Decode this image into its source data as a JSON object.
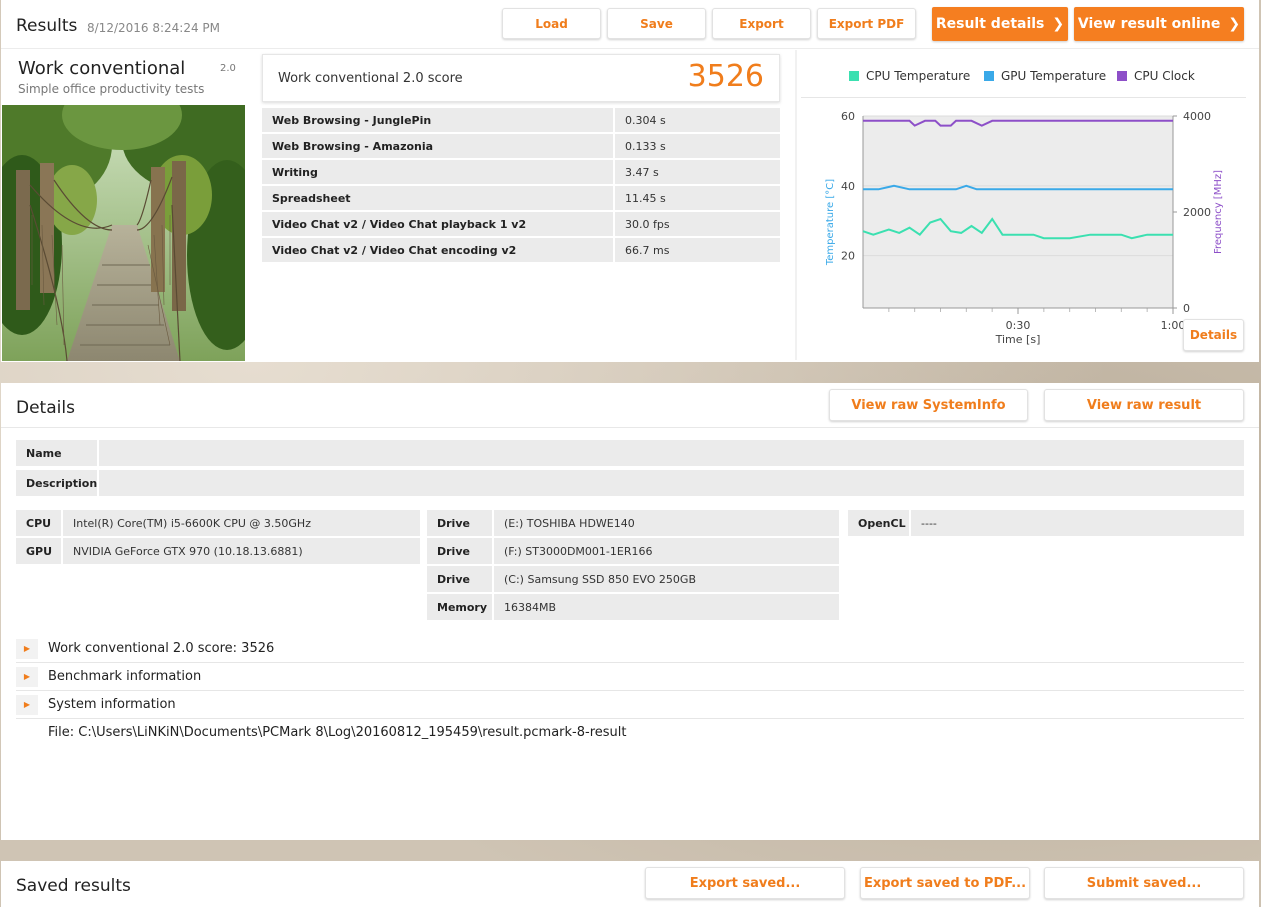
{
  "results": {
    "title": "Results",
    "timestamp": "8/12/2016 8:24:24 PM",
    "buttons": {
      "load": "Load",
      "save": "Save",
      "export": "Export",
      "export_pdf": "Export PDF"
    },
    "result_details": "Result details",
    "view_online": "View result online",
    "benchmark": {
      "name": "Work conventional",
      "version": "2.0",
      "subtitle": "Simple office productivity tests"
    },
    "score": {
      "label": "Work conventional 2.0 score",
      "value": "3526"
    },
    "subscores": [
      {
        "name": "Web Browsing - JunglePin",
        "value": "0.304 s"
      },
      {
        "name": "Web Browsing - Amazonia",
        "value": "0.133 s"
      },
      {
        "name": "Writing",
        "value": "3.47 s"
      },
      {
        "name": "Spreadsheet",
        "value": "11.45 s"
      },
      {
        "name": "Video Chat v2 / Video Chat playback 1 v2",
        "value": "30.0 fps"
      },
      {
        "name": "Video Chat v2 / Video Chat encoding v2",
        "value": "66.7 ms"
      }
    ],
    "details_button": "Details"
  },
  "chart_data": {
    "type": "line",
    "xlabel": "Time [s]",
    "ylabel_left": "Temperature [°C]",
    "ylabel_right": "Frequency [MHz]",
    "x_ticks": [
      "0:30",
      "1:00"
    ],
    "x_tick_values": [
      30,
      60
    ],
    "xlim": [
      0,
      60
    ],
    "y_left_ticks": [
      "20",
      "40",
      "60"
    ],
    "y_left_tick_values": [
      20,
      40,
      60
    ],
    "ylim_left": [
      5,
      60
    ],
    "y_right_ticks": [
      "0",
      "2000",
      "4000"
    ],
    "y_right_tick_values": [
      0,
      2000,
      4000
    ],
    "ylim_right": [
      0,
      4000
    ],
    "grid": true,
    "legend_position": "top",
    "series": [
      {
        "name": "CPU Temperature",
        "color": "#3be0b0",
        "axis": "left",
        "x": [
          0,
          2,
          5,
          7,
          9,
          11,
          13,
          15,
          17,
          19,
          21,
          23,
          25,
          27,
          29,
          31,
          33,
          35,
          40,
          44,
          47,
          50,
          52,
          55,
          60
        ],
        "values": [
          27,
          26,
          27.5,
          26.5,
          28,
          26,
          29.5,
          30.5,
          27,
          26.5,
          28.5,
          26.5,
          30.5,
          26,
          26,
          26,
          26,
          25,
          25,
          26,
          26,
          26,
          25,
          26,
          26
        ]
      },
      {
        "name": "GPU Temperature",
        "color": "#3aa9e8",
        "axis": "left",
        "x": [
          0,
          3,
          6,
          9,
          12,
          15,
          18,
          20,
          22,
          25,
          30,
          35,
          40,
          45,
          50,
          55,
          60
        ],
        "values": [
          39,
          39,
          40,
          39,
          39,
          39,
          39,
          40,
          39,
          39,
          39,
          39,
          39,
          39,
          39,
          39,
          39
        ]
      },
      {
        "name": "CPU Clock",
        "color": "#8d4fc8",
        "axis": "right",
        "x": [
          0,
          3,
          6,
          9,
          10,
          12,
          14,
          15,
          17,
          18,
          20,
          21,
          23,
          25,
          26,
          27,
          30,
          35,
          40,
          45,
          50,
          55,
          60
        ],
        "values": [
          3900,
          3900,
          3900,
          3900,
          3800,
          3900,
          3900,
          3800,
          3800,
          3900,
          3900,
          3900,
          3800,
          3900,
          3900,
          3900,
          3900,
          3900,
          3900,
          3900,
          3900,
          3900,
          3900
        ]
      }
    ]
  },
  "details": {
    "title": "Details",
    "view_raw_systeminfo": "View raw SystemInfo",
    "view_raw_result": "View raw result",
    "name_label": "Name",
    "name_value": "",
    "description_label": "Description",
    "description_value": "",
    "cpu_label": "CPU",
    "cpu_value": "Intel(R) Core(TM) i5-6600K CPU @ 3.50GHz",
    "gpu_label": "GPU",
    "gpu_value": "NVIDIA GeForce GTX 970 (10.18.13.6881)",
    "drives": [
      {
        "label": "Drive",
        "value": "(E:) TOSHIBA HDWE140"
      },
      {
        "label": "Drive",
        "value": "(F:) ST3000DM001-1ER166"
      },
      {
        "label": "Drive",
        "value": "(C:) Samsung SSD 850 EVO 250GB"
      }
    ],
    "memory_label": "Memory",
    "memory_value": "16384MB",
    "opencl_label": "OpenCL",
    "opencl_value": "----",
    "sections": [
      {
        "label": "Work conventional 2.0 score: 3526"
      },
      {
        "label": "Benchmark information"
      },
      {
        "label": "System information"
      }
    ],
    "file": "File: C:\\Users\\LiNKiN\\Documents\\PCMark 8\\Log\\20160812_195459\\result.pcmark-8-result"
  },
  "saved": {
    "title": "Saved results",
    "export_saved": "Export saved...",
    "export_saved_pdf": "Export saved to PDF...",
    "submit_saved": "Submit saved..."
  }
}
